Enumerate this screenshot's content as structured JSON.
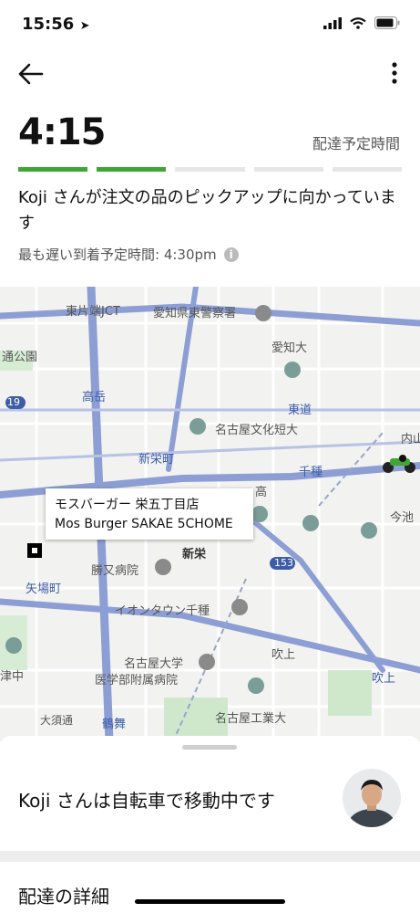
{
  "status_bar": {
    "time": "15:56"
  },
  "header": {
    "eta_time": "4:15",
    "eta_label": "配達予定時間",
    "progress_steps": [
      true,
      true,
      false,
      false,
      false
    ],
    "message": "Koji さんが注文の品のピックアップに向かっています",
    "latest_arrival": "最も遅い到着予定時間: 4:30pm"
  },
  "map": {
    "labels": {
      "jct": "東片端JCT",
      "prefecture_police": "愛知県東警察署",
      "aichi_univ": "愛知大",
      "park": "通公園",
      "takaoka": "高岳",
      "higashi_ode": "東道",
      "route19": "19",
      "culture_college": "名古屋文化短大",
      "shin_sakae": "新栄町",
      "chikusa": "千種",
      "uchiyama": "内山",
      "imaike": "今池",
      "katsumata": "勝又病院",
      "shinsakae": "新栄",
      "route153": "153",
      "yabacho": "矢場町",
      "aeon": "イオンタウン千種",
      "fukiage_station": "吹上",
      "fukiage_main": "吹上",
      "tsunaka": "津中",
      "meidai_hospital_1": "名古屋大学",
      "meidai_hospital_2": "医学部附属病院",
      "oosu": "大須通",
      "tsurumai": "鶴舞",
      "nit": "名古屋工業大",
      "takaoka_small": "高"
    },
    "store_popup": {
      "name_ja": "モスバーガー 栄五丁目店",
      "name_en": "Mos Burger SAKAE 5CHOME"
    }
  },
  "sheet": {
    "courier_status": "Koji さんは自転車で移動中です",
    "details_title": "配達の詳細"
  },
  "colors": {
    "accent_green": "#3fa535",
    "road_blue": "#8c9ed3",
    "map_bg": "#f2f2f0"
  }
}
